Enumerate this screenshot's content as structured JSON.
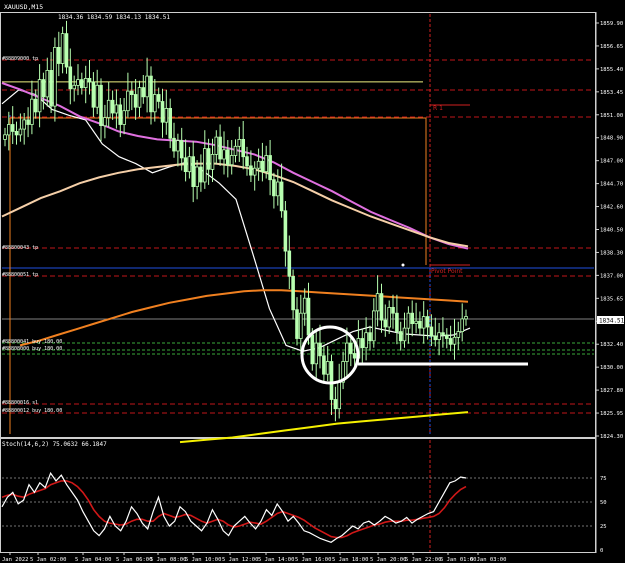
{
  "header": {
    "symbol_text": "XAUUSD,M15",
    "ohlc_text": "1834.36 1834.59 1834.13 1834.51"
  },
  "oscillator": {
    "title_text": "Stoch(14,6,2) 75.0632 66.1847",
    "levels": [
      75,
      50,
      25,
      0
    ]
  },
  "price_axis_labels": [
    "1859.90",
    "1856.65",
    "1855.40",
    "1853.45",
    "1851.00",
    "1848.90",
    "1847.00",
    "1844.70",
    "1842.60",
    "1840.50",
    "1838.30",
    "1837.00",
    "1835.65",
    "1833.80",
    "1832.40",
    "1830.00",
    "1827.80",
    "1825.95",
    "1824.30"
  ],
  "current_price_tag": "1834.51",
  "time_axis_labels": [
    "Jan 2022",
    "5 Jan 02:00",
    "5 Jan 04:00",
    "5 Jan 06:00",
    "5 Jan 08:00",
    "5 Jan 10:00",
    "5 Jan 12:00",
    "5 Jan 14:00",
    "5 Jan 16:00",
    "5 Jan 18:00",
    "5 Jan 20:00",
    "5 Jan 22:00",
    "6 Jan 01:00",
    "6 Jan 03:00"
  ],
  "annotations": {
    "r1_label": "R 1",
    "pivot_label": "Pivot Point"
  },
  "order_labels": [
    "#88809000 tp",
    "#88800043 tp",
    "#88800051 tp",
    "#88800041 buy 180.00",
    "#88808000 buy 180.00",
    "#88800016 sl",
    "#88800012 buy 180.00"
  ],
  "colors": {
    "background": "#000000",
    "candle": "#b8ffb0",
    "fast_ma": "#ffffff",
    "magenta_ma": "#e070e0",
    "peach_ma": "#f5cfa8",
    "orange_ma": "#f08020",
    "yellow_ma": "#f5f000",
    "stoch_main": "#ffffff",
    "stoch_signal": "#d01818",
    "dashed_red": "#c0161a",
    "dashed_green": "#3aa83a",
    "blue_line": "#2050e0",
    "pivot_red": "#d02020"
  },
  "chart_data": {
    "type": "line",
    "price_range": [
      1824.3,
      1860.8
    ],
    "levels": {
      "r1": 1852.2,
      "pivot": 1838.0,
      "resistance_yellow": 1854.9,
      "stop": 1826.9
    },
    "candles_close": [
      1850.3,
      1851.2,
      1850.6,
      1850.3,
      1850.8,
      1851.6,
      1851.2,
      1853.4,
      1852.3,
      1855.1,
      1853.6,
      1855.9,
      1852.8,
      1857.9,
      1856.5,
      1859.1,
      1856.2,
      1854.3,
      1854.6,
      1855.1,
      1854.4,
      1855.2,
      1854.9,
      1852.7,
      1854.6,
      1851.1,
      1851.8,
      1853.3,
      1852.2,
      1852.9,
      1851.2,
      1852.4,
      1854.1,
      1853.8,
      1852.7,
      1854.4,
      1853.6,
      1855.4,
      1852.3,
      1853.8,
      1853.2,
      1851.4,
      1852.6,
      1850.0,
      1848.9,
      1849.8,
      1848.3,
      1847.1,
      1848.4,
      1845.8,
      1847.5,
      1846.2,
      1849.1,
      1847.3,
      1848.6,
      1850.1,
      1848.2,
      1849.0,
      1847.7,
      1848.5,
      1849.3,
      1849.9,
      1848.4,
      1847.6,
      1846.8,
      1847.4,
      1848.0,
      1847.1,
      1848.5,
      1846.4,
      1845.0,
      1846.2,
      1843.7,
      1840.2,
      1838.0,
      1835.1,
      1832.6,
      1834.8,
      1836.1,
      1832.9,
      1830.4,
      1832.2,
      1831.1,
      1829.5,
      1830.6,
      1827.3,
      1826.5,
      1828.8,
      1830.6,
      1832.2,
      1831.3,
      1830.9,
      1832.6,
      1831.8,
      1833.1,
      1832.4,
      1835.0,
      1836.5,
      1834.2,
      1833.6,
      1835.3,
      1834.8,
      1833.2,
      1832.4,
      1833.5,
      1834.8,
      1833.9,
      1834.1,
      1833.5,
      1834.5,
      1833.6,
      1832.8,
      1832.5,
      1833.1,
      1832.9,
      1832.6,
      1832.1,
      1832.7,
      1833.2,
      1834.3,
      1834.51
    ],
    "stochastic": {
      "main": [
        45,
        55,
        60,
        48,
        52,
        68,
        60,
        70,
        65,
        80,
        72,
        78,
        68,
        60,
        52,
        40,
        30,
        20,
        15,
        22,
        35,
        25,
        20,
        30,
        45,
        38,
        28,
        22,
        40,
        55,
        35,
        25,
        30,
        45,
        40,
        30,
        25,
        20,
        28,
        42,
        32,
        20,
        15,
        25,
        30,
        35,
        28,
        22,
        30,
        42,
        36,
        48,
        40,
        30,
        35,
        28,
        20,
        18,
        15,
        12,
        10,
        8,
        12,
        15,
        20,
        25,
        22,
        28,
        30,
        26,
        30,
        35,
        32,
        28,
        30,
        34,
        28,
        32,
        35,
        38,
        40,
        50,
        60,
        70,
        72,
        76,
        75
      ],
      "signal": [
        55,
        57,
        58,
        56,
        55,
        58,
        60,
        62,
        64,
        68,
        70,
        72,
        72,
        70,
        66,
        60,
        52,
        42,
        35,
        30,
        28,
        27,
        26,
        27,
        30,
        32,
        32,
        30,
        30,
        35,
        38,
        36,
        34,
        35,
        37,
        36,
        33,
        30,
        28,
        30,
        32,
        30,
        26,
        24,
        25,
        27,
        29,
        28,
        27,
        30,
        34,
        38,
        40,
        38,
        36,
        34,
        31,
        27,
        23,
        20,
        17,
        14,
        13,
        13,
        15,
        18,
        20,
        22,
        24,
        26,
        27,
        29,
        30,
        30,
        30,
        31,
        31,
        32,
        33,
        34,
        35,
        38,
        44,
        52,
        58,
        63,
        66
      ]
    },
    "indicator_lines": [
      {
        "name": "fast_ma",
        "values": [
          1853.0,
          1854.2,
          1853.8,
          1852.5,
          1852.0,
          1851.6,
          1849.5,
          1848.4,
          1847.8,
          1847.0,
          1847.5,
          1847.9,
          1847.2,
          1846.1,
          1844.7,
          1840.0,
          1835.2,
          1832.0,
          1831.5,
          1831.8,
          1832.5,
          1833.2,
          1833.6,
          1833.3,
          1833.0,
          1832.9,
          1832.8,
          1832.9,
          1833.5
        ]
      },
      {
        "name": "magenta_ma",
        "values": [
          1854.8,
          1854.2,
          1853.5,
          1852.8,
          1851.9,
          1851.3,
          1850.6,
          1850.2,
          1849.9,
          1849.8,
          1849.7,
          1849.4,
          1849.0,
          1848.6,
          1847.9,
          1847.0,
          1846.2,
          1845.4,
          1844.5,
          1843.6,
          1842.9,
          1842.2,
          1841.4,
          1840.8,
          1840.4
        ]
      },
      {
        "name": "peach_ma",
        "values": [
          1843.2,
          1844.0,
          1844.8,
          1845.4,
          1846.1,
          1846.6,
          1847.0,
          1847.3,
          1847.5,
          1847.7,
          1847.8,
          1847.8,
          1847.6,
          1847.3,
          1846.8,
          1846.2,
          1845.4,
          1844.6,
          1843.9,
          1843.2,
          1842.6,
          1842.0,
          1841.4,
          1840.9,
          1840.6
        ]
      },
      {
        "name": "orange_ma",
        "values": [
          1832.0,
          1832.4,
          1832.9,
          1833.4,
          1833.9,
          1834.4,
          1834.9,
          1835.3,
          1835.7,
          1836.0,
          1836.3,
          1836.5,
          1836.7,
          1836.8,
          1836.8,
          1836.7,
          1836.6,
          1836.5,
          1836.4,
          1836.3,
          1836.2,
          1836.1,
          1836.0,
          1835.9,
          1835.8
        ]
      },
      {
        "name": "yellow_ma",
        "values": [
          1823.6,
          1823.8,
          1824.0,
          1824.3,
          1824.6,
          1824.9,
          1825.2,
          1825.4,
          1825.6,
          1825.8,
          1826.0,
          1826.2
        ]
      }
    ]
  }
}
